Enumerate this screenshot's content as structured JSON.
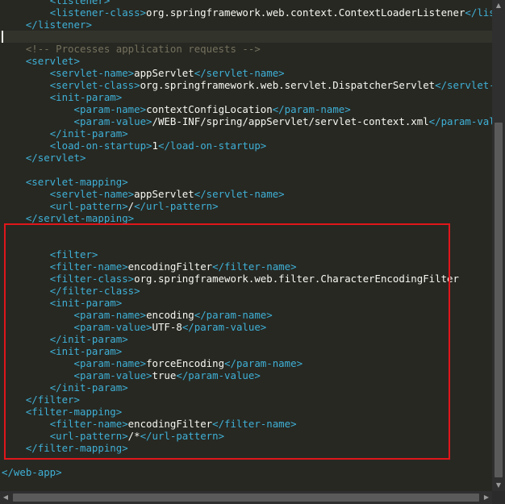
{
  "editor": {
    "lines": [
      {
        "segments": [
          {
            "t": "        ",
            "c": "tx"
          },
          {
            "t": "<listener>",
            "c": "tag"
          }
        ]
      },
      {
        "segments": [
          {
            "t": "        ",
            "c": "tx"
          },
          {
            "t": "<listener-class>",
            "c": "tag"
          },
          {
            "t": "org.springframework.web.context.ContextLoaderListener",
            "c": "tx"
          },
          {
            "t": "</listener-class>",
            "c": "tag"
          }
        ]
      },
      {
        "segments": [
          {
            "t": "    ",
            "c": "tx"
          },
          {
            "t": "</listener>",
            "c": "tag"
          }
        ]
      },
      {
        "segments": [
          {
            "t": "",
            "c": "tx"
          }
        ],
        "current": true
      },
      {
        "segments": [
          {
            "t": "    ",
            "c": "tx"
          },
          {
            "t": "<!-- Processes application requests -->",
            "c": "cm"
          }
        ]
      },
      {
        "segments": [
          {
            "t": "    ",
            "c": "tx"
          },
          {
            "t": "<servlet>",
            "c": "tag"
          }
        ]
      },
      {
        "segments": [
          {
            "t": "        ",
            "c": "tx"
          },
          {
            "t": "<servlet-name>",
            "c": "tag"
          },
          {
            "t": "appServlet",
            "c": "tx"
          },
          {
            "t": "</servlet-name>",
            "c": "tag"
          }
        ]
      },
      {
        "segments": [
          {
            "t": "        ",
            "c": "tx"
          },
          {
            "t": "<servlet-class>",
            "c": "tag"
          },
          {
            "t": "org.springframework.web.servlet.DispatcherServlet",
            "c": "tx"
          },
          {
            "t": "</servlet-class>",
            "c": "tag"
          }
        ]
      },
      {
        "segments": [
          {
            "t": "        ",
            "c": "tx"
          },
          {
            "t": "<init-param>",
            "c": "tag"
          }
        ]
      },
      {
        "segments": [
          {
            "t": "            ",
            "c": "tx"
          },
          {
            "t": "<param-name>",
            "c": "tag"
          },
          {
            "t": "contextConfigLocation",
            "c": "tx"
          },
          {
            "t": "</param-name>",
            "c": "tag"
          }
        ]
      },
      {
        "segments": [
          {
            "t": "            ",
            "c": "tx"
          },
          {
            "t": "<param-value>",
            "c": "tag"
          },
          {
            "t": "/WEB-INF/spring/appServlet/servlet-context.xml",
            "c": "tx"
          },
          {
            "t": "</param-value>",
            "c": "tag"
          }
        ]
      },
      {
        "segments": [
          {
            "t": "        ",
            "c": "tx"
          },
          {
            "t": "</init-param>",
            "c": "tag"
          }
        ]
      },
      {
        "segments": [
          {
            "t": "        ",
            "c": "tx"
          },
          {
            "t": "<load-on-startup>",
            "c": "tag"
          },
          {
            "t": "1",
            "c": "tx"
          },
          {
            "t": "</load-on-startup>",
            "c": "tag"
          }
        ]
      },
      {
        "segments": [
          {
            "t": "    ",
            "c": "tx"
          },
          {
            "t": "</servlet>",
            "c": "tag"
          }
        ]
      },
      {
        "segments": [
          {
            "t": "",
            "c": "tx"
          }
        ]
      },
      {
        "segments": [
          {
            "t": "    ",
            "c": "tx"
          },
          {
            "t": "<servlet-mapping>",
            "c": "tag"
          }
        ]
      },
      {
        "segments": [
          {
            "t": "        ",
            "c": "tx"
          },
          {
            "t": "<servlet-name>",
            "c": "tag"
          },
          {
            "t": "appServlet",
            "c": "tx"
          },
          {
            "t": "</servlet-name>",
            "c": "tag"
          }
        ]
      },
      {
        "segments": [
          {
            "t": "        ",
            "c": "tx"
          },
          {
            "t": "<url-pattern>",
            "c": "tag"
          },
          {
            "t": "/",
            "c": "tx"
          },
          {
            "t": "</url-pattern>",
            "c": "tag"
          }
        ]
      },
      {
        "segments": [
          {
            "t": "    ",
            "c": "tx"
          },
          {
            "t": "</servlet-mapping>",
            "c": "tag"
          }
        ]
      },
      {
        "segments": [
          {
            "t": "",
            "c": "tx"
          }
        ]
      },
      {
        "segments": [
          {
            "t": "",
            "c": "tx"
          }
        ]
      },
      {
        "segments": [
          {
            "t": "        ",
            "c": "tx"
          },
          {
            "t": "<filter>",
            "c": "tag"
          }
        ]
      },
      {
        "segments": [
          {
            "t": "        ",
            "c": "tx"
          },
          {
            "t": "<filter-name>",
            "c": "tag"
          },
          {
            "t": "encodingFilter",
            "c": "tx"
          },
          {
            "t": "</filter-name>",
            "c": "tag"
          }
        ]
      },
      {
        "segments": [
          {
            "t": "        ",
            "c": "tx"
          },
          {
            "t": "<filter-class>",
            "c": "tag"
          },
          {
            "t": "org.springframework.web.filter.CharacterEncodingFilter",
            "c": "tx"
          }
        ]
      },
      {
        "segments": [
          {
            "t": "        ",
            "c": "tx"
          },
          {
            "t": "</filter-class>",
            "c": "tag"
          }
        ]
      },
      {
        "segments": [
          {
            "t": "        ",
            "c": "tx"
          },
          {
            "t": "<init-param>",
            "c": "tag"
          }
        ]
      },
      {
        "segments": [
          {
            "t": "            ",
            "c": "tx"
          },
          {
            "t": "<param-name>",
            "c": "tag"
          },
          {
            "t": "encoding",
            "c": "tx"
          },
          {
            "t": "</param-name>",
            "c": "tag"
          }
        ]
      },
      {
        "segments": [
          {
            "t": "            ",
            "c": "tx"
          },
          {
            "t": "<param-value>",
            "c": "tag"
          },
          {
            "t": "UTF-8",
            "c": "tx"
          },
          {
            "t": "</param-value>",
            "c": "tag"
          }
        ]
      },
      {
        "segments": [
          {
            "t": "        ",
            "c": "tx"
          },
          {
            "t": "</init-param>",
            "c": "tag"
          }
        ]
      },
      {
        "segments": [
          {
            "t": "        ",
            "c": "tx"
          },
          {
            "t": "<init-param>",
            "c": "tag"
          }
        ]
      },
      {
        "segments": [
          {
            "t": "            ",
            "c": "tx"
          },
          {
            "t": "<param-name>",
            "c": "tag"
          },
          {
            "t": "forceEncoding",
            "c": "tx"
          },
          {
            "t": "</param-name>",
            "c": "tag"
          }
        ]
      },
      {
        "segments": [
          {
            "t": "            ",
            "c": "tx"
          },
          {
            "t": "<param-value>",
            "c": "tag"
          },
          {
            "t": "true",
            "c": "tx"
          },
          {
            "t": "</param-value>",
            "c": "tag"
          }
        ]
      },
      {
        "segments": [
          {
            "t": "        ",
            "c": "tx"
          },
          {
            "t": "</init-param>",
            "c": "tag"
          }
        ]
      },
      {
        "segments": [
          {
            "t": "    ",
            "c": "tx"
          },
          {
            "t": "</filter>",
            "c": "tag"
          }
        ]
      },
      {
        "segments": [
          {
            "t": "    ",
            "c": "tx"
          },
          {
            "t": "<filter-mapping>",
            "c": "tag"
          }
        ]
      },
      {
        "segments": [
          {
            "t": "        ",
            "c": "tx"
          },
          {
            "t": "<filter-name>",
            "c": "tag"
          },
          {
            "t": "encodingFilter",
            "c": "tx"
          },
          {
            "t": "</filter-name>",
            "c": "tag"
          }
        ]
      },
      {
        "segments": [
          {
            "t": "        ",
            "c": "tx"
          },
          {
            "t": "<url-pattern>",
            "c": "tag"
          },
          {
            "t": "/*",
            "c": "tx"
          },
          {
            "t": "</url-pattern>",
            "c": "tag"
          }
        ]
      },
      {
        "segments": [
          {
            "t": "    ",
            "c": "tx"
          },
          {
            "t": "</filter-mapping>",
            "c": "tag"
          }
        ]
      },
      {
        "segments": [
          {
            "t": "",
            "c": "tx"
          }
        ]
      },
      {
        "segments": [
          {
            "t": "",
            "c": "tx"
          },
          {
            "t": "</web-app>",
            "c": "tag"
          }
        ]
      }
    ]
  },
  "annotation": {
    "color": "#e0161b"
  },
  "colors": {
    "background": "#272822",
    "tag": "#3fb0d6",
    "comment": "#75715e",
    "text": "#f8f8f2"
  },
  "scrollbars": {
    "up_icon": "▲",
    "down_icon": "▼",
    "left_icon": "◀",
    "right_icon": "▶"
  }
}
